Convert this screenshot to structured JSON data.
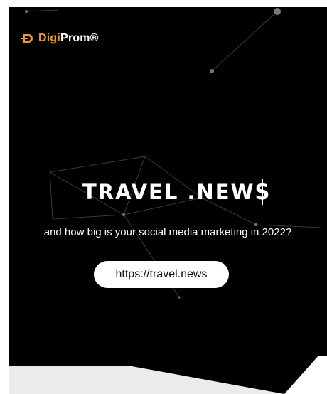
{
  "brand": {
    "name_part1": "Digi",
    "name_part2": "Prom®",
    "accent_color": "#f29a1d"
  },
  "hero": {
    "title": "TRAVEL .NEWS",
    "subtitle": "and how big is your social media marketing in 2022?",
    "url_button": "https://travel.news",
    "background_color": "#000000"
  }
}
